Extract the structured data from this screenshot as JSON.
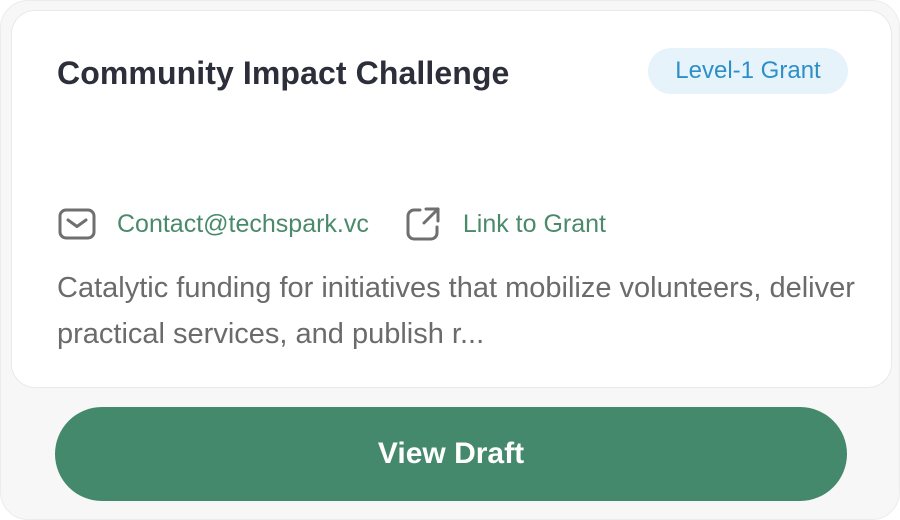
{
  "card": {
    "title": "Community Impact Challenge",
    "badge": "Level-1 Grant",
    "contact": {
      "icon": "mail-icon",
      "label": "Contact@techspark.vc"
    },
    "link": {
      "icon": "external-link-icon",
      "label": "Link to Grant"
    },
    "description": "Catalytic funding for initiatives that mobilize volunteers, deliver practical services, and publish r..."
  },
  "cta": {
    "label": "View Draft"
  },
  "colors": {
    "accent_green": "#44896b",
    "link_green": "#4a8a6a",
    "badge_bg": "#e6f3fb",
    "badge_text": "#2d8fc7",
    "title_text": "#2c2f3a",
    "body_text": "#6b6b6b"
  }
}
